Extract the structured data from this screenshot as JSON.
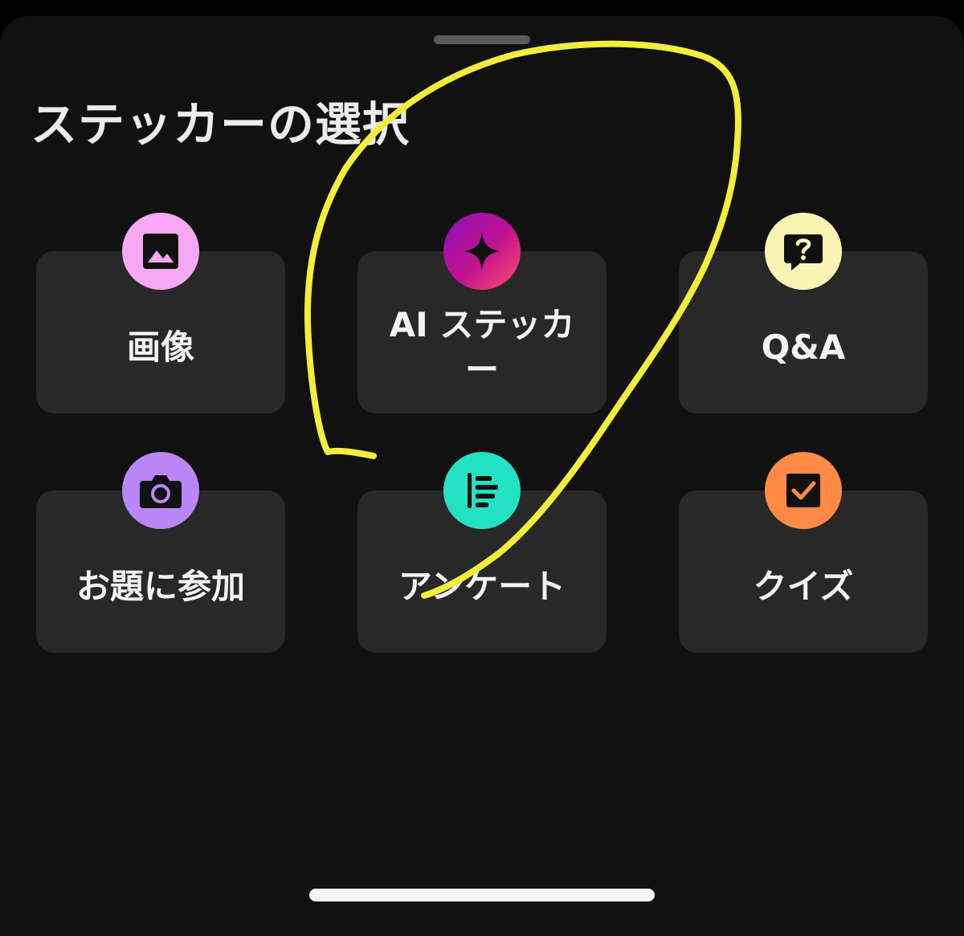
{
  "sheet": {
    "title": "ステッカーの選択"
  },
  "stickers": [
    {
      "label": "画像",
      "icon": "image-icon",
      "color": "#f7a8f3"
    },
    {
      "label": "AI ステッカー",
      "icon": "sparkle-icon",
      "color": "#b0189c"
    },
    {
      "label": "Q&A",
      "icon": "question-bubble-icon",
      "color": "#fbf5b4"
    },
    {
      "label": "お題に参加",
      "icon": "camera-icon",
      "color": "#bb86f5"
    },
    {
      "label": "アンケート",
      "icon": "poll-icon",
      "color": "#23e2c3"
    },
    {
      "label": "クイズ",
      "icon": "checkbox-icon",
      "color": "#ff8a45"
    }
  ],
  "annotation": {
    "color": "#f2ee3a"
  }
}
